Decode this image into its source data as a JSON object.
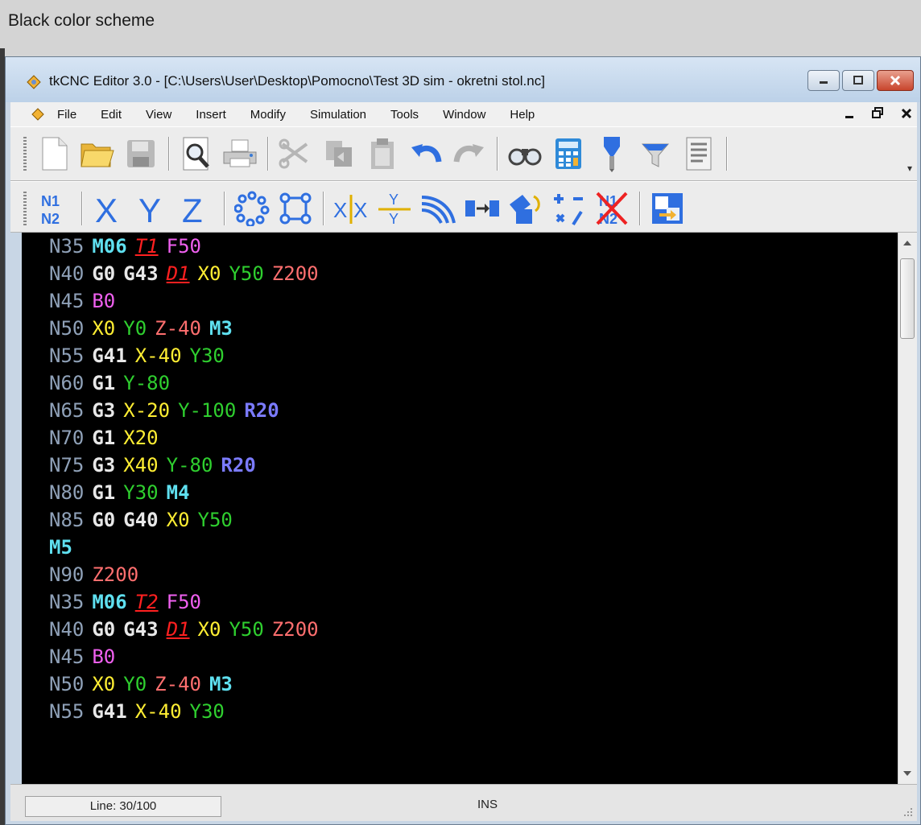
{
  "caption": "Black color scheme",
  "window": {
    "title": "tkCNC Editor 3.0 - [C:\\Users\\User\\Desktop\\Pomocno\\Test 3D sim - okretni stol.nc]"
  },
  "menu": [
    "File",
    "Edit",
    "View",
    "Insert",
    "Modify",
    "Simulation",
    "Tools",
    "Window",
    "Help"
  ],
  "toolbar2_labels": {
    "renumber_top": "N1",
    "renumber_bottom": "N2",
    "axis_x": "X",
    "axis_y": "Y",
    "axis_z": "Z",
    "mirror_x": "X",
    "mirror_x2": "X",
    "swap_top": "Y",
    "swap_bottom": "Y",
    "remove_top": "N1",
    "remove_bottom": "N2"
  },
  "colors": {
    "N": "#8fa1b8",
    "G": "#e8e8e8",
    "M": "#5fe0f0",
    "R": "#7b7bff",
    "X": "#ffee33",
    "Y": "#2fcf2f",
    "Z": "#ff6f6f",
    "F": "#f060f0",
    "T": "#ff2020"
  },
  "code": [
    [
      [
        "N",
        "N35"
      ],
      [
        "M",
        "M06"
      ],
      [
        "T",
        "T1"
      ],
      [
        "F",
        "F50"
      ]
    ],
    [
      [
        "N",
        "N40"
      ],
      [
        "G",
        "G0"
      ],
      [
        "G",
        "G43"
      ],
      [
        "D",
        "D1"
      ],
      [
        "X",
        "X0"
      ],
      [
        "Y",
        "Y50"
      ],
      [
        "Z",
        "Z200"
      ]
    ],
    [
      [
        "N",
        "N45"
      ],
      [
        "B",
        "B0"
      ]
    ],
    [
      [
        "N",
        "N50"
      ],
      [
        "X",
        "X0"
      ],
      [
        "Y",
        "Y0"
      ],
      [
        "Z",
        "Z-40"
      ],
      [
        "M",
        "M3"
      ]
    ],
    [
      [
        "N",
        "N55"
      ],
      [
        "G",
        "G41"
      ],
      [
        "X",
        "X-40"
      ],
      [
        "Y",
        "Y30"
      ]
    ],
    [
      [
        "N",
        "N60"
      ],
      [
        "G",
        "G1"
      ],
      [
        "Y",
        "Y-80"
      ]
    ],
    [
      [
        "N",
        "N65"
      ],
      [
        "G",
        "G3"
      ],
      [
        "X",
        "X-20"
      ],
      [
        "Y",
        "Y-100"
      ],
      [
        "R",
        "R20"
      ]
    ],
    [
      [
        "N",
        "N70"
      ],
      [
        "G",
        "G1"
      ],
      [
        "X",
        "X20"
      ]
    ],
    [
      [
        "N",
        "N75"
      ],
      [
        "G",
        "G3"
      ],
      [
        "X",
        "X40"
      ],
      [
        "Y",
        "Y-80"
      ],
      [
        "R",
        "R20"
      ]
    ],
    [
      [
        "N",
        "N80"
      ],
      [
        "G",
        "G1"
      ],
      [
        "Y",
        "Y30"
      ],
      [
        "M",
        "M4"
      ]
    ],
    [
      [
        "N",
        "N85"
      ],
      [
        "G",
        "G0"
      ],
      [
        "G",
        "G40"
      ],
      [
        "X",
        "X0"
      ],
      [
        "Y",
        "Y50"
      ]
    ],
    [
      [
        "M",
        "M5"
      ]
    ],
    [
      [
        "N",
        "N90"
      ],
      [
        "Z",
        "Z200"
      ]
    ],
    [
      [
        "N",
        "N35"
      ],
      [
        "M",
        "M06"
      ],
      [
        "T",
        "T2"
      ],
      [
        "F",
        "F50"
      ]
    ],
    [
      [
        "N",
        "N40"
      ],
      [
        "G",
        "G0"
      ],
      [
        "G",
        "G43"
      ],
      [
        "D",
        "D1"
      ],
      [
        "X",
        "X0"
      ],
      [
        "Y",
        "Y50"
      ],
      [
        "Z",
        "Z200"
      ]
    ],
    [
      [
        "N",
        "N45"
      ],
      [
        "B",
        "B0"
      ]
    ],
    [
      [
        "N",
        "N50"
      ],
      [
        "X",
        "X0"
      ],
      [
        "Y",
        "Y0"
      ],
      [
        "Z",
        "Z-40"
      ],
      [
        "M",
        "M3"
      ]
    ],
    [
      [
        "N",
        "N55"
      ],
      [
        "G",
        "G41"
      ],
      [
        "X",
        "X-40"
      ],
      [
        "Y",
        "Y30"
      ]
    ]
  ],
  "status": {
    "line": "Line: 30/100",
    "mode": "INS"
  }
}
